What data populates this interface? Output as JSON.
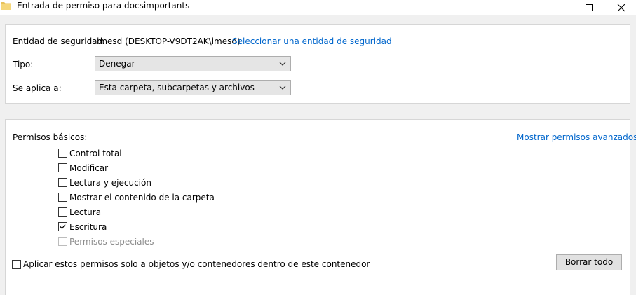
{
  "window": {
    "title": "Entrada de permiso para docsimportants",
    "minimize_icon": "minimize-icon",
    "maximize_icon": "maximize-icon",
    "close_icon": "close-icon"
  },
  "principal": {
    "label": "Entidad de seguridad:",
    "value": "imesd (DESKTOP-V9DT2AK\\imesd)",
    "select_link": "Seleccionar una entidad de seguridad"
  },
  "type": {
    "label": "Tipo:",
    "value": "Denegar"
  },
  "applies_to": {
    "label": "Se aplica a:",
    "value": "Esta carpeta, subcarpetas y archivos"
  },
  "permissions": {
    "label": "Permisos básicos:",
    "advanced_link": "Mostrar permisos avanzados",
    "items": [
      {
        "label": "Control total",
        "checked": false,
        "enabled": true
      },
      {
        "label": "Modificar",
        "checked": false,
        "enabled": true
      },
      {
        "label": "Lectura y ejecución",
        "checked": false,
        "enabled": true
      },
      {
        "label": "Mostrar el contenido de la carpeta",
        "checked": false,
        "enabled": true
      },
      {
        "label": "Lectura",
        "checked": false,
        "enabled": true
      },
      {
        "label": "Escritura",
        "checked": true,
        "enabled": true
      },
      {
        "label": "Permisos especiales",
        "checked": false,
        "enabled": false
      }
    ]
  },
  "apply_only": {
    "label": "Aplicar estos permisos solo a objetos y/o contenedores dentro de este contenedor",
    "checked": false
  },
  "clear_all_button": "Borrar todo"
}
